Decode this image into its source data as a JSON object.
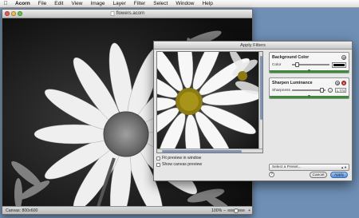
{
  "menubar": {
    "app_name": "Acorn",
    "items": [
      "File",
      "Edit",
      "View",
      "Image",
      "Layer",
      "Filter",
      "Select",
      "Window",
      "Help"
    ]
  },
  "document": {
    "title": "flowers.acorn",
    "status": {
      "canvas_size": "Canvas: 800x600",
      "zoom": "100%"
    }
  },
  "filter_panel": {
    "title": "Apply Filters",
    "fit_preview_label": "Fit preview in window",
    "show_canvas_preview_label": "Show canvas preview",
    "filters": [
      {
        "name": "Background Color",
        "param_label": "Color",
        "param_color": "#000000"
      },
      {
        "name": "Sharpen Luminance",
        "param_label": "Sharpness",
        "param_value": "1.774",
        "param_level": 0.9
      }
    ],
    "preset_placeholder": "Select a Preset...",
    "help_label": "?",
    "cancel_label": "Cancel",
    "apply_label": "Apply"
  },
  "colors": {
    "desktop": "#6f8fb5",
    "filter_card_accent": "#3f8a3a",
    "apply_button": "#4f8ee0"
  }
}
